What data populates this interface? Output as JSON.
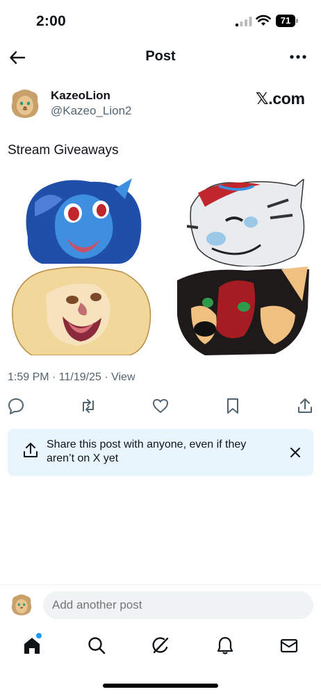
{
  "status_bar": {
    "time": "2:00",
    "battery": "71"
  },
  "header": {
    "title": "Post",
    "back_icon": "arrow-left-icon",
    "more_icon": "more-horizontal-icon"
  },
  "post": {
    "author_name": "KazeoLion",
    "author_handle": "@Kazeo_Lion2",
    "source_label": "𝕏.com",
    "text": "Stream Giveaways",
    "timestamp": "1:59 PM · 11/19/25 · View",
    "images": [
      "blue-dragon-emote",
      "white-tiger-wink-emote",
      "lion-roar-emote",
      "red-black-canine-emote"
    ]
  },
  "actions": [
    "reply-icon",
    "repost-icon",
    "like-icon",
    "bookmark-icon",
    "share-icon"
  ],
  "share_banner": {
    "text": "Share this post with anyone, even if they aren’t on X yet",
    "close_icon": "close-icon"
  },
  "reply_bar": {
    "placeholder": "Add another post"
  },
  "tabbar": [
    "home-icon",
    "search-icon",
    "grok-icon",
    "notifications-icon",
    "messages-icon"
  ],
  "colors": {
    "accent": "#1d9bf0",
    "muted": "#536471",
    "banner_bg": "#e8f5fd"
  }
}
